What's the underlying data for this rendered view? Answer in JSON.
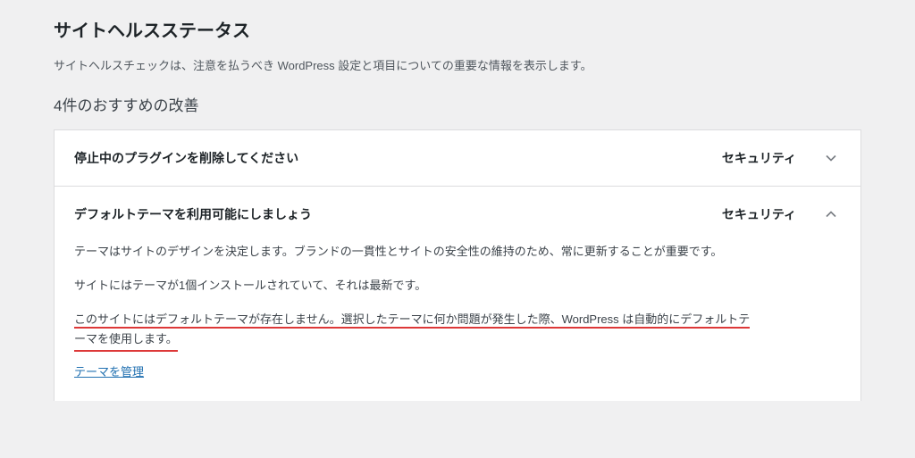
{
  "header": {
    "title": "サイトヘルスステータス",
    "description": "サイトヘルスチェックは、注意を払うべき WordPress 設定と項目についての重要な情報を表示します。",
    "improvements_heading": "4件のおすすめの改善"
  },
  "items": [
    {
      "title": "停止中のプラグインを削除してください",
      "badge": "セキュリティ",
      "expanded": false
    },
    {
      "title": "デフォルトテーマを利用可能にしましょう",
      "badge": "セキュリティ",
      "expanded": true,
      "body": {
        "p1": "テーマはサイトのデザインを決定します。ブランドの一貫性とサイトの安全性の維持のため、常に更新することが重要です。",
        "p2": "サイトにはテーマが1個インストールされていて、それは最新です。",
        "p3_part1": "このサイトにはデフォルトテーマが存在しません。選択したテーマに何か問題が発生した際、WordPress は自動的にデフォルトテ",
        "p3_part2": "ーマを使用します。",
        "link": "テーマを管理"
      }
    }
  ]
}
